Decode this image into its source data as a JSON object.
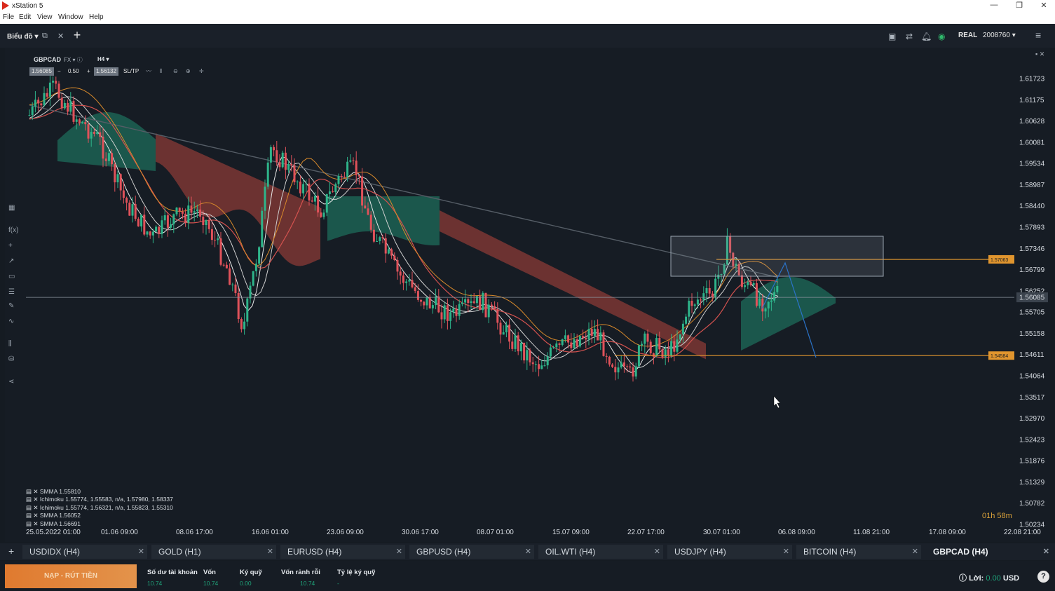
{
  "window": {
    "title": "xStation 5"
  },
  "menu": [
    "File",
    "Edit",
    "View",
    "Window",
    "Help"
  ],
  "topbar": {
    "chart_menu": "Biểu đồ",
    "account_type": "REAL",
    "account_number": "2008760"
  },
  "chart": {
    "symbol": "GBPCAD",
    "market": "FX",
    "timeframe": "H4",
    "bid": "1.56085",
    "spread": "0.50",
    "ask": "1.56132",
    "sltp": "SL/TP",
    "price_labels": [
      "1.61723",
      "1.61175",
      "1.60628",
      "1.60081",
      "1.59534",
      "1.58987",
      "1.58440",
      "1.57893",
      "1.57346",
      "1.56799",
      "1.56252",
      "1.55705",
      "1.55158",
      "1.54611",
      "1.54064",
      "1.53517",
      "1.52970",
      "1.52423",
      "1.51876",
      "1.51329",
      "1.50782",
      "1.50234"
    ],
    "current_price": "1.56085",
    "hline_upper": "1.57063",
    "hline_lower": "1.54584",
    "date_labels": [
      "25.05.2022 01:00",
      "01.06 09:00",
      "08.06 17:00",
      "16.06 01:00",
      "23.06 09:00",
      "30.06 17:00",
      "08.07 01:00",
      "15.07 09:00",
      "22.07 17:00",
      "30.07 01:00",
      "06.08 09:00",
      "11.08 21:00",
      "17.08 09:00",
      "22.08 21:00"
    ],
    "indicators": [
      "SMMA 1.55810",
      "Ichimoku 1.55774, 1.55583, n/a, 1.57980, 1.58337",
      "Ichimoku 1.55774, 1.56321, n/a, 1.55823, 1.55310",
      "SMMA 1.56052",
      "SMMA 1.56691"
    ],
    "countdown": "01h 58m",
    "colors": {
      "bull": "#2eb48a",
      "bear": "#e0525a",
      "level": "#e0952e",
      "bull_cloud": "#1e6b5a",
      "bear_cloud": "#8a3a36"
    }
  },
  "tabs": [
    {
      "label": "USDIDX (H4)"
    },
    {
      "label": "GOLD (H1)"
    },
    {
      "label": "EURUSD (H4)"
    },
    {
      "label": "GBPUSD (H4)"
    },
    {
      "label": "OIL.WTI (H4)"
    },
    {
      "label": "USDJPY (H4)"
    },
    {
      "label": "BITCOIN (H4)"
    },
    {
      "label": "GBPCAD (H4)"
    }
  ],
  "bottom": {
    "deposit_button": "NẠP - RÚT TIỀN",
    "balance_label": "Số dư tài khoản",
    "balance_value": "10.74",
    "equity_label": "Vốn",
    "equity_value": "10.74",
    "margin_label": "Ký quỹ",
    "margin_value": "0.00",
    "free_margin_label": "Vốn rảnh rỗi",
    "free_margin_value": "10.74",
    "margin_level_label": "Tỷ lệ ký quỹ",
    "margin_level_value": "-",
    "profit_label": "Lời:",
    "profit_value": "0.00",
    "currency": "USD"
  }
}
